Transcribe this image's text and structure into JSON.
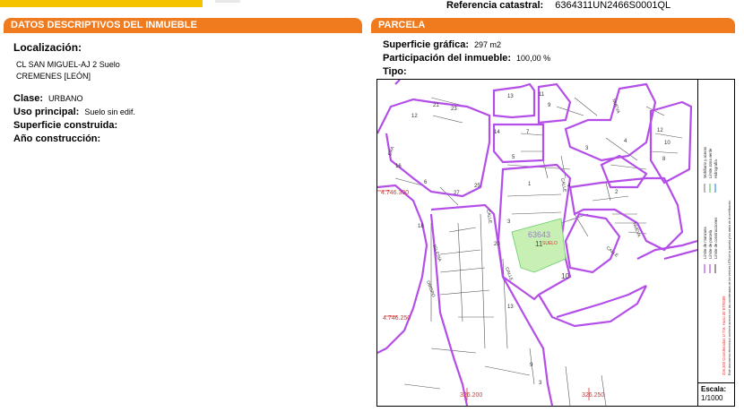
{
  "header": {
    "ref_label": "Referencia catastral:",
    "ref_value": "6364311UN2466S0001QL"
  },
  "left": {
    "title": "DATOS DESCRIPTIVOS DEL INMUEBLE",
    "localizacion_label": "Localización:",
    "address_line1": "CL SAN MIGUEL-AJ 2 Suelo",
    "address_line2": "CREMENES [LEÓN]",
    "clase_label": "Clase:",
    "clase_value": "URBANO",
    "uso_label": "Uso principal:",
    "uso_value": "Suelo sin edif.",
    "superficie_label": "Superficie construida:",
    "anio_label": "Año construcción:"
  },
  "right": {
    "title": "PARCELA",
    "superficie_label": "Superficie gráfica:",
    "superficie_value": "297 m2",
    "participacion_label": "Participación del inmueble:",
    "participacion_value": "100,00 %",
    "tipo_label": "Tipo:"
  },
  "map": {
    "coord_y_top": "4.746.300",
    "coord_y_bottom": "4.746.250",
    "coord_x_left": "326.200",
    "coord_x_right": "326.250",
    "parcel_number": "63643",
    "parcel_sub": "11",
    "parcel_label": "SUELO",
    "parcel_10": "10",
    "street_calle": "CALLE",
    "street_nueva": "NUEVA",
    "street_era": "ERA",
    "street_iglesia": "IGLESIA",
    "street_oblispo": "OBISPO",
    "nums": {
      "n12": "12",
      "n13": "13",
      "n11": "11",
      "n9": "9",
      "n7": "7",
      "n5": "5",
      "n4": "4",
      "n3": "3",
      "n2": "2",
      "n1": "1",
      "n10": "10",
      "n14": "14",
      "n6": "6",
      "n8": "8",
      "n16": "16",
      "n18": "18",
      "n20": "20",
      "n21": "21",
      "n23": "23",
      "n25": "25",
      "n27": "27"
    },
    "legend_line1": "Límite de manzana",
    "legend_line2": "Límite de parcela",
    "legend_line3": "Límite de construcciones",
    "legend_line4": "Mobiliario y aceras",
    "legend_line5": "Límite zona verde",
    "legend_line6": "Hidrografía",
    "legend_note1": "326,300 Coordenadas U.T.M. Huso 30 ETRS89",
    "legend_note2": "Este documento electrónico contiene anexos con las coordenadas de los vértices UTM de la parcela y los datos de la certificación.",
    "scale_label": "Escala:",
    "scale_value": "1/1000"
  },
  "colors": {
    "accent": "#f07a1e",
    "yellow": "#f5c400",
    "block_line": "#b44ee8",
    "coord": "#d33",
    "parcel_fill": "#c8f0b4"
  }
}
